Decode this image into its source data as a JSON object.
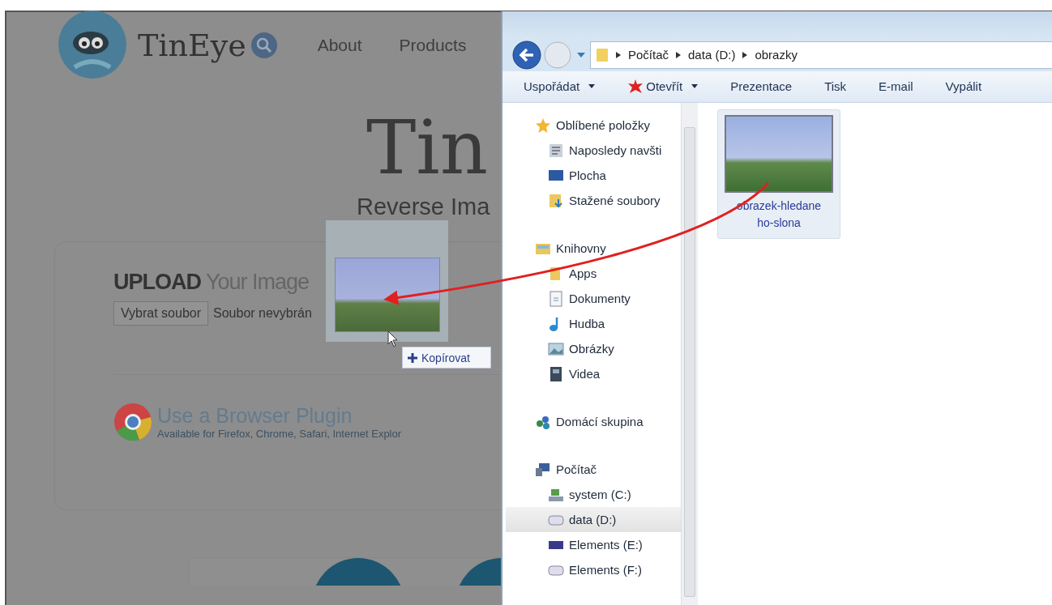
{
  "web_page": {
    "brand": "TinEye",
    "nav": [
      "About",
      "Products"
    ],
    "hero_title": "Tin",
    "subtitle": "Reverse Ima",
    "upload": {
      "heading": "**UPLOAD** Your Image",
      "file_button": "Vybrat soubor",
      "file_status": "Soubor nevybrán"
    },
    "plugin": {
      "title": "Use a Browser Plugin",
      "subtitle": "Available for Firefox, Chrome, Safari, Internet Explor"
    }
  },
  "explorer": {
    "breadcrumb": [
      "Počítač",
      "data (D:)",
      "obrazky"
    ],
    "toolbar": [
      {
        "label": "Uspořádat",
        "dropdown": true
      },
      {
        "label": "Otevřít",
        "dropdown": true
      },
      {
        "label": "Prezentace",
        "dropdown": false
      },
      {
        "label": "Tisk",
        "dropdown": false
      },
      {
        "label": "E-mail",
        "dropdown": false
      },
      {
        "label": "Vypálit",
        "dropdown": false
      }
    ],
    "nav_tree": [
      {
        "label": "Oblíbené položky",
        "selected": false,
        "children": [
          {
            "label": "Naposledy navšti",
            "selected": false
          },
          {
            "label": "Plocha",
            "selected": false
          },
          {
            "label": "Stažené soubory",
            "selected": false
          }
        ]
      },
      {
        "label": "Knihovny",
        "selected": false,
        "children": [
          {
            "label": "Apps",
            "selected": false
          },
          {
            "label": "Dokumenty",
            "selected": false
          },
          {
            "label": "Hudba",
            "selected": false
          },
          {
            "label": "Obrázky",
            "selected": false
          },
          {
            "label": "Videa",
            "selected": false
          }
        ]
      },
      {
        "label": "Domácí skupina",
        "selected": false
      },
      {
        "label": "Počítač",
        "selected": false,
        "children": [
          {
            "label": "system (C:)",
            "selected": false
          },
          {
            "label": "data (D:)",
            "selected": true
          },
          {
            "label": "Elements (E:)",
            "selected": false
          },
          {
            "label": "Elements (F:)",
            "selected": false
          }
        ]
      }
    ],
    "files": [
      {
        "name": "obrazek-hledaneho-slona",
        "selected": true
      }
    ]
  },
  "drag": {
    "tooltip": "Kopírovat"
  }
}
